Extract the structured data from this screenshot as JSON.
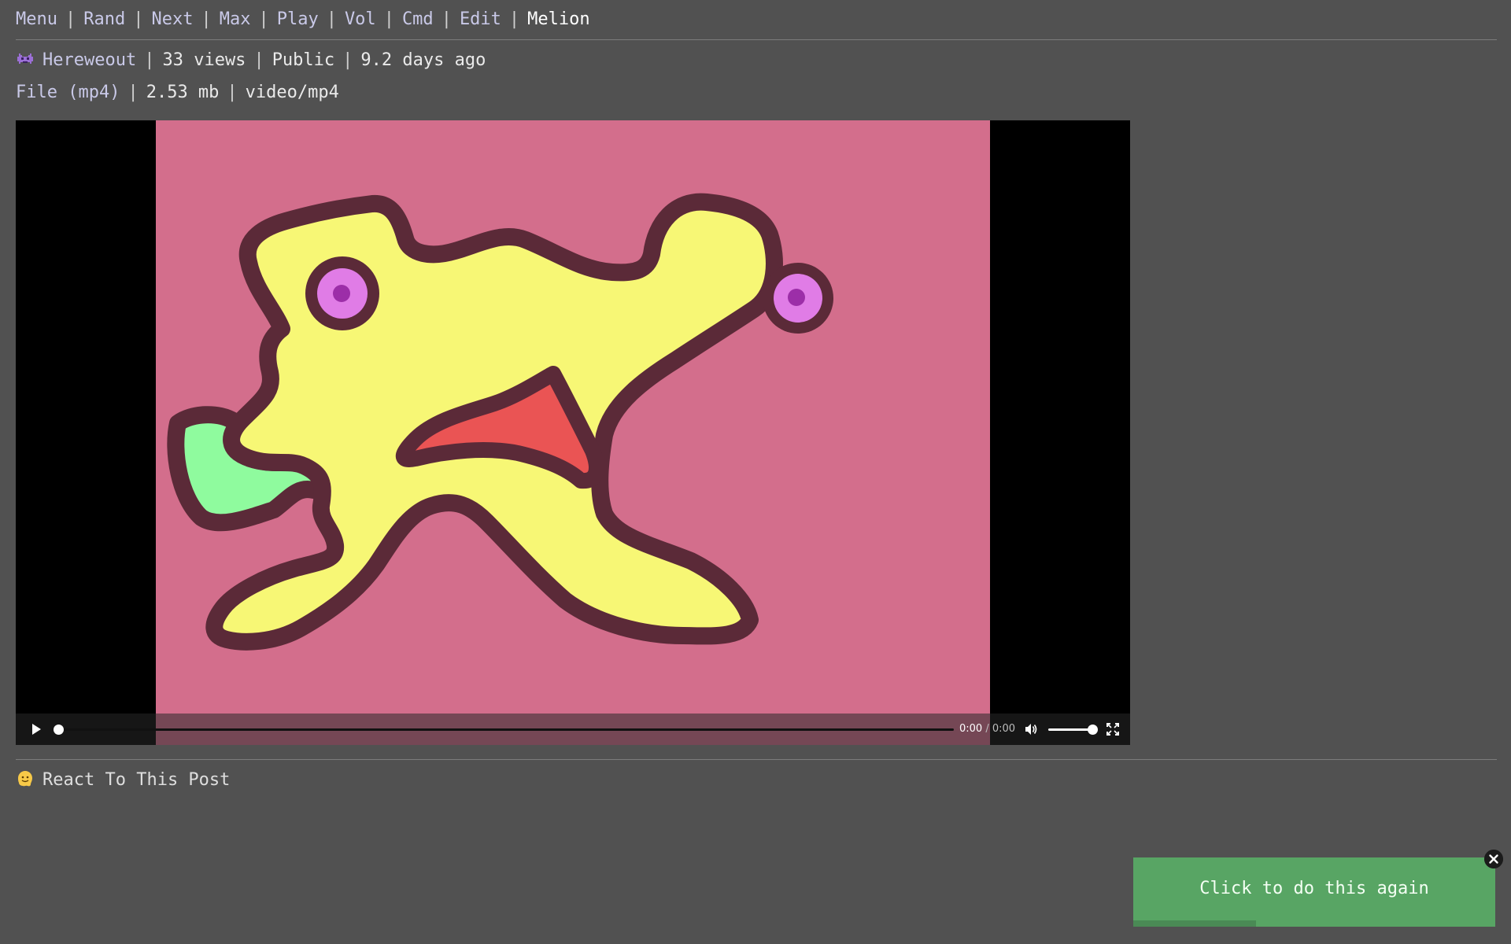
{
  "nav": {
    "items": [
      "Menu",
      "Rand",
      "Next",
      "Max",
      "Play",
      "Vol",
      "Cmd",
      "Edit"
    ],
    "current": "Melion",
    "separator": "|"
  },
  "post": {
    "user_icon": "alien-monster-icon",
    "user": "Hereweout",
    "views": "33 views",
    "visibility": "Public",
    "age": "9.2 days ago"
  },
  "file": {
    "label": "File (mp4)",
    "size": "2.53 mb",
    "mime": "video/mp4"
  },
  "video": {
    "current_time": "0:00",
    "duration": "0:00",
    "progress": 0,
    "volume": 1.0,
    "background_color": "#d36e8c",
    "icons": [
      "play-icon",
      "volume-icon",
      "fullscreen-icon"
    ]
  },
  "react": {
    "icon": "melting-face-icon",
    "label": "React To This Post"
  },
  "toast": {
    "text": "Click to do this again",
    "progress": 0.34,
    "color": "#58a564",
    "close_icon": "close-icon"
  }
}
